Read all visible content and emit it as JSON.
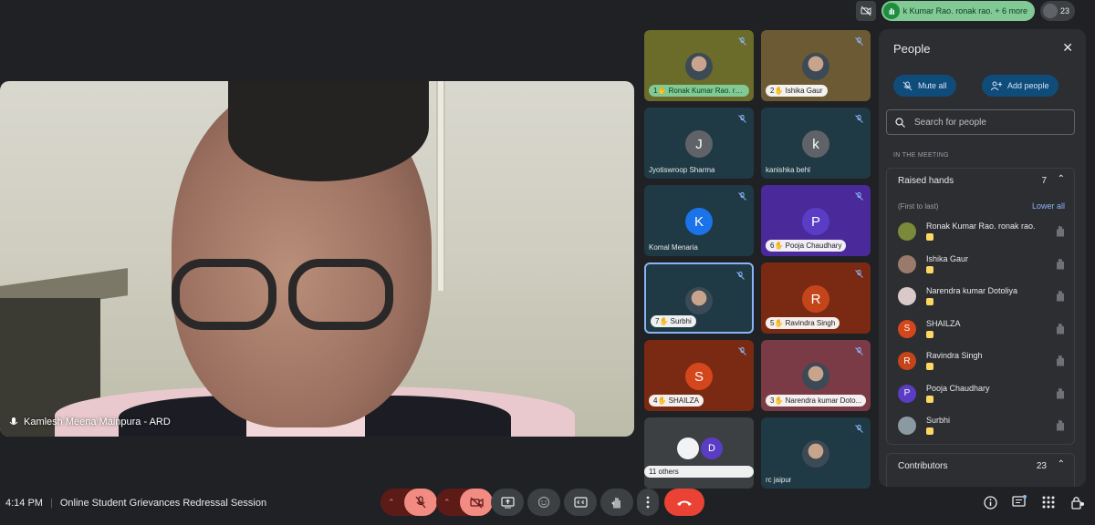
{
  "topbar": {
    "raised_hands_chip": "k Kumar Rao. ronak rao. + 6 more",
    "participant_count": "23"
  },
  "main_video": {
    "speaker_name": "Kamlesh Meena Mainpura - ARD"
  },
  "tiles": [
    {
      "label": "1✋ Ronak Kumar Rao. ron...",
      "type": "photo",
      "color": "#6b6b2a"
    },
    {
      "label": "2✋ Ishika Gaur",
      "type": "photo",
      "color": "#6b5a34"
    },
    {
      "label": "Jyotiswroop Sharma",
      "initial": "J",
      "type": "letter",
      "color": "#1f3a44",
      "avatar_color": "#5f6368"
    },
    {
      "label": "kanishka behl",
      "initial": "k",
      "type": "letter",
      "color": "#1f3a44",
      "avatar_color": "#5f6368"
    },
    {
      "label": "Komal Menaria",
      "initial": "K",
      "type": "letter",
      "color": "#1f3a44",
      "avatar_color": "#1a73e8"
    },
    {
      "label": "6✋ Pooja Chaudhary",
      "initial": "P",
      "type": "letter",
      "color": "#4a2a9a",
      "avatar_color": "#5b3cc4"
    },
    {
      "label": "7✋ Surbhi",
      "type": "photo",
      "color": "#1f3a44"
    },
    {
      "label": "5✋ Ravindra Singh",
      "initial": "R",
      "type": "letter",
      "color": "#7a2a12",
      "avatar_color": "#c5451b"
    },
    {
      "label": "4✋ SHAILZA",
      "initial": "S",
      "type": "letter",
      "color": "#7a2a12",
      "avatar_color": "#d4461c"
    },
    {
      "label": "3✋ Narendra kumar Doto...",
      "type": "photo",
      "color": "#7a3a46"
    },
    {
      "label": "11 others",
      "type": "others",
      "color": "#3c4043",
      "initial": "D"
    },
    {
      "label": "rc jaipur",
      "type": "photo",
      "color": "#1f3a44"
    }
  ],
  "people_panel": {
    "title": "People",
    "mute_all": "Mute all",
    "add_people": "Add people",
    "search_placeholder": "Search for people",
    "section_label": "IN THE MEETING",
    "raised_hands_header": "Raised hands",
    "raised_hands_count": "7",
    "order_note": "(First to last)",
    "lower_all": "Lower all",
    "raised": [
      {
        "name": "Ronak Kumar Rao. ronak rao.",
        "initial": "",
        "color": "#7a8a3a"
      },
      {
        "name": "Ishika Gaur",
        "initial": "",
        "color": "#9a7a6a"
      },
      {
        "name": "Narendra kumar Dotoliya",
        "initial": "",
        "color": "#d9c9c9"
      },
      {
        "name": "SHAILZA",
        "initial": "S",
        "color": "#d4461c"
      },
      {
        "name": "Ravindra Singh",
        "initial": "R",
        "color": "#c5451b"
      },
      {
        "name": "Pooja Chaudhary",
        "initial": "P",
        "color": "#5b3cc4"
      },
      {
        "name": "Surbhi",
        "initial": "",
        "color": "#8a9aa0"
      }
    ],
    "contributors_header": "Contributors",
    "contributors_count": "23"
  },
  "bottom": {
    "time": "4:14 PM",
    "meeting_title": "Online Student Grievances Redressal Session"
  }
}
